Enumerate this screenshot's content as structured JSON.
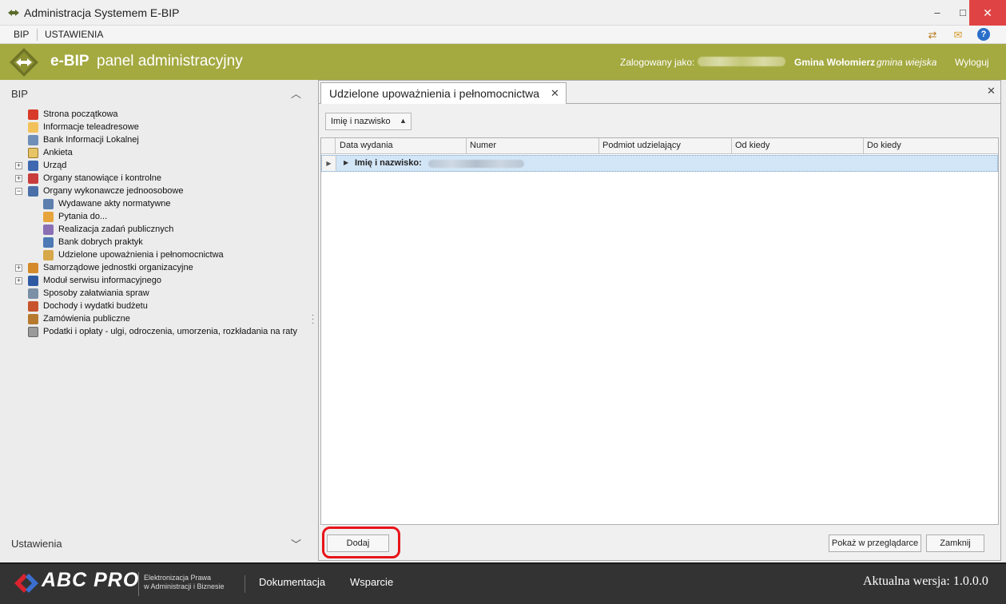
{
  "window": {
    "title": "Administracja Systemem E-BIP",
    "minimize": "–",
    "maximize": "□",
    "close": "✕"
  },
  "menubar": {
    "items": [
      "BIP",
      "USTAWIENIA"
    ],
    "tools": [
      "⇄",
      "✉",
      "?"
    ]
  },
  "header": {
    "brand": "e-BIP",
    "panel_title": "panel administracyjny",
    "logged_as_label": "Zalogowany jako:",
    "gmina": "Gmina Wołomierz",
    "gmina_type": "gmina wiejska",
    "logout": "Wyloguj"
  },
  "sidebar": {
    "section_title": "BIP",
    "collapse_glyph": "︿",
    "bottom_title": "Ustawienia",
    "expand_glyph": "﹀",
    "items": [
      {
        "label": "Strona początkowa",
        "toggle": ""
      },
      {
        "label": "Informacje teleadresowe",
        "toggle": ""
      },
      {
        "label": "Bank Informacji Lokalnej",
        "toggle": ""
      },
      {
        "label": "Ankieta",
        "toggle": ""
      },
      {
        "label": "Urząd",
        "toggle": "+"
      },
      {
        "label": "Organy stanowiące i kontrolne",
        "toggle": "+"
      },
      {
        "label": "Organy wykonawcze jednoosobowe",
        "toggle": "−"
      },
      {
        "label": "Wydawane akty normatywne",
        "toggle": ""
      },
      {
        "label": "Pytania do...",
        "toggle": ""
      },
      {
        "label": "Realizacja zadań publicznych",
        "toggle": ""
      },
      {
        "label": "Bank dobrych praktyk",
        "toggle": ""
      },
      {
        "label": "Udzielone upoważnienia i pełnomocnictwa",
        "toggle": ""
      },
      {
        "label": "Samorządowe jednostki organizacyjne",
        "toggle": "+"
      },
      {
        "label": "Moduł serwisu informacyjnego",
        "toggle": "+"
      },
      {
        "label": "Sposoby załatwiania spraw",
        "toggle": ""
      },
      {
        "label": "Dochody i wydatki budżetu",
        "toggle": ""
      },
      {
        "label": "Zamówienia publiczne",
        "toggle": ""
      },
      {
        "label": "Podatki i opłaty - ulgi, odroczenia, umorzenia, rozkładania na raty",
        "toggle": ""
      }
    ]
  },
  "main": {
    "tab_label": "Udzielone upoważnienia i pełnomocnictwa",
    "tab_close": "✕",
    "panel_close": "✕",
    "group_chip": "Imię i nazwisko",
    "group_chip_arrow": "▲",
    "columns": [
      "Data wydania",
      "Numer",
      "Podmiot udzielający",
      "Od kiedy",
      "Do kiedy"
    ],
    "group_row_label": "Imię i nazwisko:",
    "row_indicator": "▶",
    "row_expander": "▶",
    "buttons": {
      "add": "Dodaj",
      "show": "Pokaż w przeglądarce",
      "close": "Zamknij"
    }
  },
  "footer": {
    "brand": "ABC PRO",
    "tagline_1": "Elektronizacja Prawa",
    "tagline_2": "w Administracji i Biznesie",
    "link_docs": "Dokumentacja",
    "link_support": "Wsparcie",
    "version": "Aktualna wersja: 1.0.0.0"
  },
  "colors": {
    "header_green": "#a4a940",
    "highlight_red": "#e8141a",
    "group_row_blue": "#d3e6f7",
    "footer_dark": "#333333"
  }
}
